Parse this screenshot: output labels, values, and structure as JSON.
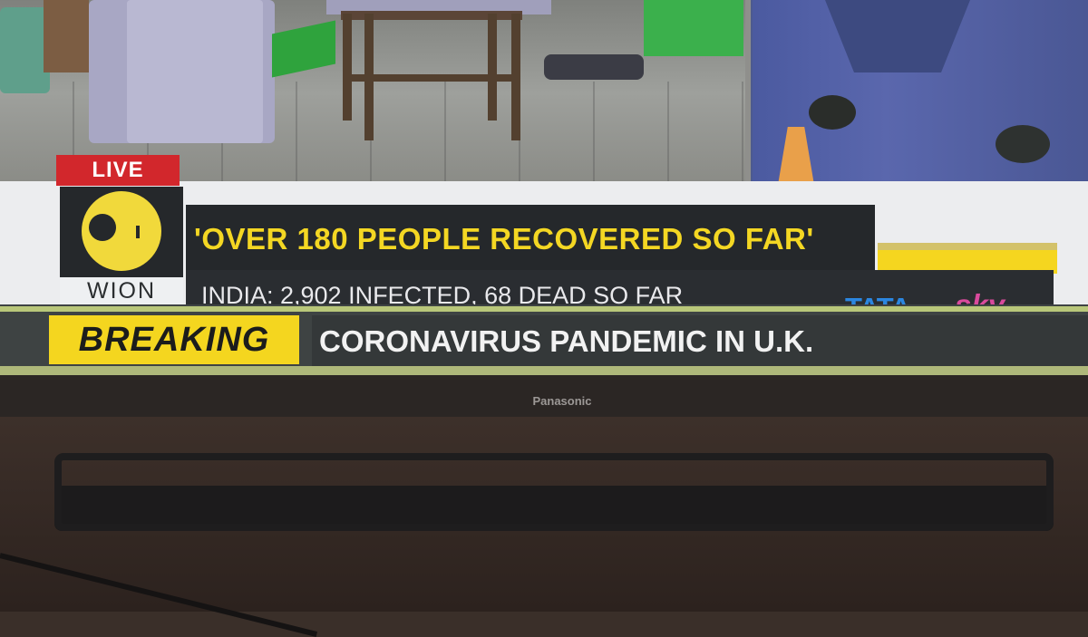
{
  "overlay": {
    "live_label": "LIVE",
    "channel_logo_text": "WION",
    "headline": "'OVER 180 PEOPLE RECOVERED SO FAR'",
    "subline": "INDIA: 2,902 INFECTED, 68 DEAD SO FAR",
    "provider_tata": "TATA",
    "provider_sky": "sky",
    "breaking_label": "BREAKING",
    "breaking_text": "CORONAVIRUS PANDEMIC IN U.K."
  },
  "tv": {
    "brand": "Panasonic"
  },
  "colors": {
    "live_red": "#d2272c",
    "headline_yellow": "#f4d723",
    "breaking_yellow": "#f4d61f",
    "bar_dark": "#25282b",
    "tata_blue": "#2b86e0",
    "sky_pink": "#d94a9c"
  }
}
